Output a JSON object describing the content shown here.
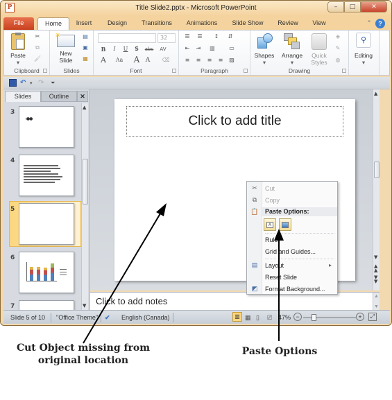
{
  "window": {
    "title": "Title Slide2.pptx  -  Microsoft PowerPoint",
    "app_icon": "P",
    "controls": {
      "minimize": "–",
      "maximize": "□",
      "close": "✕"
    }
  },
  "tabs": [
    {
      "label": "File"
    },
    {
      "label": "Home",
      "active": true
    },
    {
      "label": "Insert"
    },
    {
      "label": "Design"
    },
    {
      "label": "Transitions"
    },
    {
      "label": "Animations"
    },
    {
      "label": "Slide Show"
    },
    {
      "label": "Review"
    },
    {
      "label": "View"
    }
  ],
  "ribbon": {
    "clipboard": {
      "label": "Clipboard",
      "paste": "Paste"
    },
    "slides": {
      "label": "Slides",
      "new_slide_line1": "New",
      "new_slide_line2": "Slide"
    },
    "font": {
      "label": "Font",
      "font_name": "",
      "font_size": "32",
      "bold": "B",
      "italic": "I",
      "underline": "U",
      "shadow": "S",
      "strike": "abc",
      "spacing": "AV",
      "font_color": "A",
      "change_case": "Aa",
      "grow": "A",
      "shrink": "A"
    },
    "paragraph": {
      "label": "Paragraph"
    },
    "drawing": {
      "label": "Drawing",
      "shapes": "Shapes",
      "arrange": "Arrange",
      "quick_styles_line1": "Quick",
      "quick_styles_line2": "Styles"
    },
    "editing": {
      "label": "Editing"
    }
  },
  "qat": {
    "save": "save-icon",
    "undo": "undo-icon",
    "redo": "redo-icon",
    "customize": "customize-icon"
  },
  "slides_pane": {
    "tabs": [
      {
        "label": "Slides",
        "active": true
      },
      {
        "label": "Outline"
      }
    ],
    "close": "✕",
    "thumbnails": [
      {
        "number": "3",
        "content": "icons"
      },
      {
        "number": "4",
        "content": "text"
      },
      {
        "number": "5",
        "content": "blank",
        "selected": true
      },
      {
        "number": "6",
        "content": "chart"
      },
      {
        "number": "7",
        "content": "blank"
      }
    ]
  },
  "slide": {
    "title_placeholder": "Click to add title"
  },
  "notes": {
    "placeholder": "Click to add notes"
  },
  "context_menu": {
    "items": [
      {
        "label": "Cut",
        "icon": "scissors-icon",
        "disabled": true
      },
      {
        "label": "Copy",
        "icon": "copy-icon",
        "disabled": true
      },
      {
        "label": "Paste Options:",
        "header": true
      },
      {
        "label": "Ruler"
      },
      {
        "label": "Grid and Guides..."
      },
      {
        "label": "Layout",
        "submenu": true
      },
      {
        "label": "Reset Slide"
      },
      {
        "label": "Format Background..."
      }
    ],
    "submenu_arrow": "▸"
  },
  "status_bar": {
    "slide_info": "Slide 5 of 10",
    "theme": "\"Office Theme\"",
    "language": "English (Canada)",
    "zoom": "47%"
  },
  "annotations": {
    "cut_caption_line1": "Cut Object missing from",
    "cut_caption_line2": "original location",
    "paste_caption": "Paste Options"
  },
  "colors": {
    "file_tab": "#d45a33",
    "selected_slide": "#fbd67e",
    "title_bar": "#f4d39e"
  }
}
